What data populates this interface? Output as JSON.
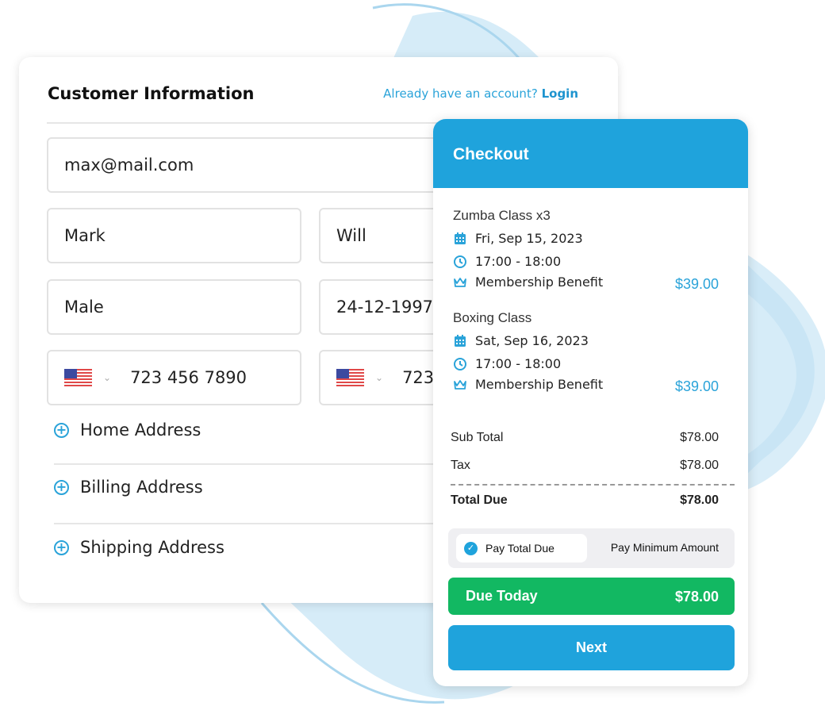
{
  "customer_info": {
    "title": "Customer Information",
    "login_prompt": "Already have an account?",
    "login_link": "Login",
    "email": "max@mail.com",
    "first_name": "Mark",
    "last_name": "Will",
    "gender": "Male",
    "birth_date": "24-12-1997",
    "phone_1": "723 456 7890",
    "phone_2": "723",
    "accordions": [
      "Home Address",
      "Billing Address",
      "Shipping Address"
    ]
  },
  "checkout": {
    "title": "Checkout",
    "items": [
      {
        "name": "Zumba Class x3",
        "date": "Fri, Sep 15, 2023",
        "time": "17:00 - 18:00",
        "benefit": "Membership Benefit",
        "price": "$39.00"
      },
      {
        "name": "Boxing Class",
        "date": "Sat, Sep 16, 2023",
        "time": "17:00 - 18:00",
        "benefit": "Membership Benefit",
        "price": "$39.00"
      }
    ],
    "sub_total_label": "Sub Total",
    "sub_total": "$78.00",
    "tax_label": "Tax",
    "tax": "$78.00",
    "total_label": "Total Due",
    "total": "$78.00",
    "pay_total_label": "Pay Total Due",
    "pay_min_label": "Pay Minimum Amount",
    "due_today_label": "Due Today",
    "due_today": "$78.00",
    "next_label": "Next"
  },
  "colors": {
    "accent": "#1fa3dc",
    "success": "#12b862"
  }
}
